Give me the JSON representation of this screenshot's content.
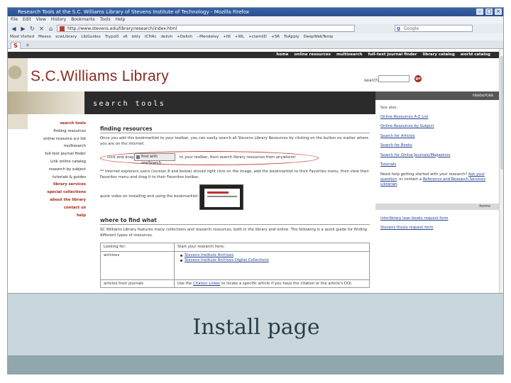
{
  "browser": {
    "title": "Research Tools at the S.C. Williams Library of Stevens Institute of Technology - Mozilla Firefox",
    "window_buttons": [
      "–",
      "□",
      "×"
    ],
    "menu": [
      "File",
      "Edit",
      "View",
      "History",
      "Bookmarks",
      "Tools",
      "Help"
    ],
    "url": "http://www.stevens.edu/library/research/index.html",
    "search_placeholder": "Google",
    "bookmarks": [
      "Most Visited",
      "Meeso",
      "scwLibrary",
      "LibGuides",
      "TrypoD",
      "s6",
      "bitly",
      "ICHAc",
      "delish",
      "+Delish",
      "--Mendeley",
      "+NI",
      "+WL",
      "+claimID",
      "+SR",
      "ToApply",
      "DeepWebTemp"
    ],
    "tab_label": "S",
    "tab_plus": "+"
  },
  "site": {
    "top_nav": [
      "home",
      "online resources",
      "multisearch",
      "full-text journal finder",
      "library catalog",
      "world catalog"
    ],
    "title": "S.C.Williams Library",
    "search_label": "search:",
    "search_go": "go",
    "banner_title": "search tools",
    "right_head": "resources",
    "left_nav": [
      {
        "label": "search tools",
        "red": true
      },
      {
        "label": "finding resources",
        "red": false
      },
      {
        "label": "online resource a-z list",
        "red": false
      },
      {
        "label": "multisearch",
        "red": false
      },
      {
        "label": "full-text journal finder",
        "red": false
      },
      {
        "label": "Link online catalog",
        "red": false
      },
      {
        "label": "research by subject",
        "red": false
      },
      {
        "label": "tutorials & guides",
        "red": false
      },
      {
        "label": "library services",
        "red": true
      },
      {
        "label": "special collections",
        "red": true
      },
      {
        "label": "about the library",
        "red": true
      },
      {
        "label": "contact us",
        "red": true
      },
      {
        "label": "help",
        "red": true
      }
    ],
    "finding": {
      "heading": "finding resources",
      "intro": "Once you add this bookmarklet to your toolbar, you can easily search all Stevens Library Resources by clicking on the button no matter where you are on the internet.",
      "click_drag": "click and drag",
      "bm_button": "find with oneSearch",
      "bm_after": "to your toolbar, then search library resources from anywhere!",
      "ie_note": "** Internet explorers users (version 8 and below) should right click on the image, add the bookmarklet to their Favorites menu, then view their Favorites menu and drag it to their Favorites toolbar.",
      "video_label": "quick video on installing and using the bookmarklet:"
    },
    "where": {
      "heading": "where to find what",
      "intro": "SC Williams Library features many collections and research resources, both in the library and online. The following is a quick guide for finding different types of resources.",
      "col1_head": "Looking for:",
      "col2_head": "Start your research here:",
      "rows": [
        {
          "looking": "archives",
          "links": [
            "Stevens Institute Archives",
            "Stevens Institute Archives Digital Collections"
          ],
          "text": ""
        },
        {
          "looking": "articles from journals",
          "links": [],
          "text_prefix": "Use the",
          "text_link": "Citation Linker",
          "text_suffix": "to locate a specific article if you have the citation or the article's DOI."
        }
      ]
    },
    "sidebar": {
      "see_also": "See also:",
      "links": [
        "Online Resources A-Z List",
        "Online Resources by Subject",
        "Search for Articles",
        "Search for Books",
        "Search for Online Journals/Magazines",
        "Tutorials"
      ],
      "help_text_prefix": "Need help getting started with your research?",
      "help_link1": "Ask your question",
      "help_mid": ", or contact a",
      "help_link2": "Reference and Research Services Librarian",
      "help_end": ".",
      "forms_head": "forms",
      "form_links": [
        "interlibrary loan books request form",
        "Stevens thesis request form"
      ]
    }
  },
  "caption": "Install page"
}
